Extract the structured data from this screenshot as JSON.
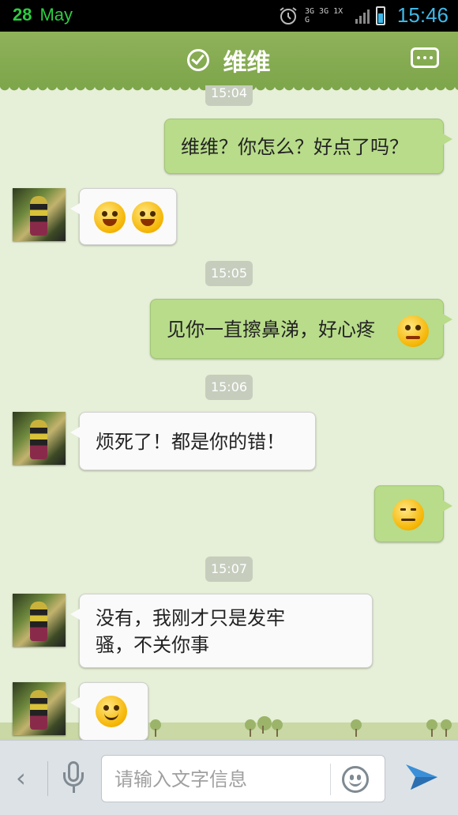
{
  "status_bar": {
    "date_day": "28",
    "date_month": "May",
    "network": "3G 3G 1X G",
    "time": "15:46"
  },
  "header": {
    "title": "维维",
    "verified_icon": "check-circle-icon",
    "menu_icon": "more-menu-icon"
  },
  "messages": {
    "t1": "15:04",
    "m1": "维维？你怎么？好点了吗？",
    "m2_emoji": "laugh-emoji",
    "t2": "15:05",
    "m3": "见你一直擦鼻涕，好心疼",
    "m3_emoji": "teary-emoji",
    "t3": "15:06",
    "m4": "烦死了！都是你的错！",
    "m5_emoji": "speechless-emoji",
    "t4": "15:07",
    "m6_line1": "没有，我刚才只是发牢",
    "m6_line2": "骚，不关你事",
    "m7_emoji": "smile-emoji"
  },
  "input_bar": {
    "back_icon": "chevron-left-icon",
    "mic_icon": "microphone-icon",
    "placeholder": "请输入文字信息",
    "emoji_icon": "smiley-icon",
    "send_icon": "send-icon"
  },
  "colors": {
    "header_green": "#8fb25a",
    "sent_bubble": "#b8dc8a",
    "received_bubble": "#fafafa",
    "chat_bg": "#e6efd7",
    "clock_blue": "#3fb8e8"
  }
}
